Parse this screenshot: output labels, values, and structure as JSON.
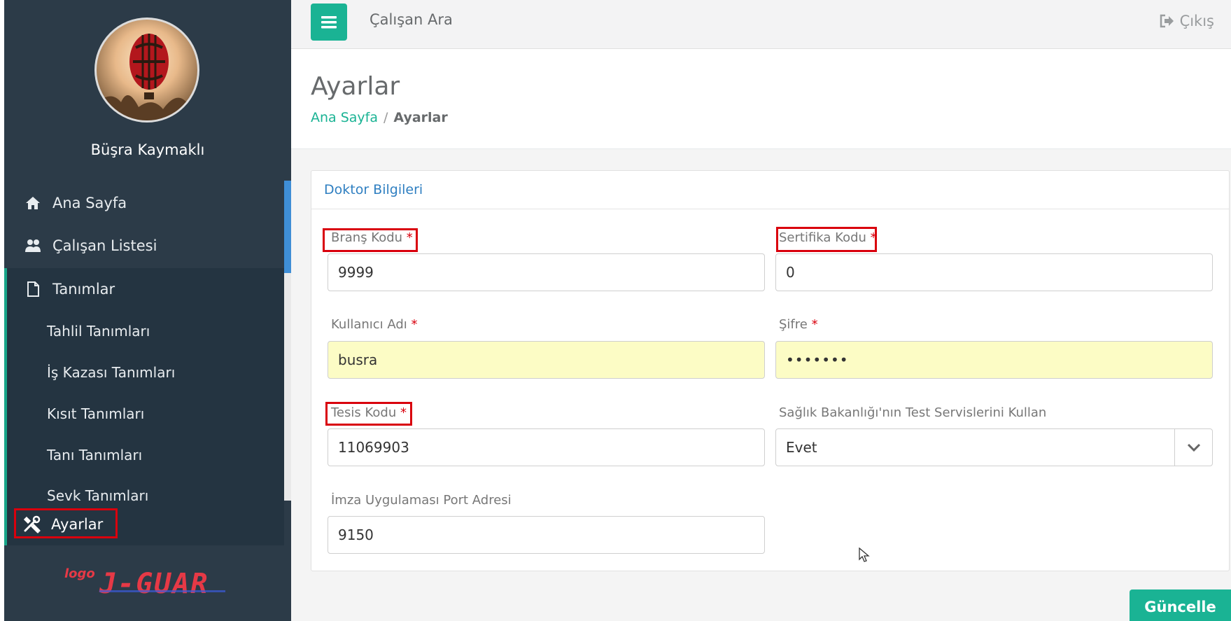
{
  "user": {
    "name": "Büşra Kaymaklı"
  },
  "sidebar": {
    "items": [
      {
        "label": "Ana Sayfa",
        "icon": "home-icon"
      },
      {
        "label": "Çalışan Listesi",
        "icon": "users-icon"
      },
      {
        "label": "Tanımlar",
        "icon": "file-icon"
      }
    ],
    "subitems": [
      {
        "label": "Tahlil Tanımları"
      },
      {
        "label": "İş Kazası Tanımları"
      },
      {
        "label": "Kısıt Tanımları"
      },
      {
        "label": "Tanı Tanımları"
      },
      {
        "label": "Sevk Tanımları"
      }
    ],
    "settings": {
      "label": "Ayarlar",
      "icon": "tools-icon"
    }
  },
  "topbar": {
    "search_label": "Çalışan Ara",
    "logout_label": "Çıkış"
  },
  "heading": {
    "title": "Ayarlar",
    "breadcrumb": {
      "home": "Ana Sayfa",
      "separator": "/",
      "current": "Ayarlar"
    }
  },
  "panel": {
    "title": "Doktor Bilgileri",
    "fields": {
      "brans_kodu": {
        "label": "Branş Kodu",
        "required": "*",
        "value": "9999"
      },
      "sertifika_kodu": {
        "label": "Sertifika Kodu",
        "required": "*",
        "value": "0"
      },
      "kullanici_adi": {
        "label": "Kullanıcı Adı",
        "required": "*",
        "value": "busra"
      },
      "sifre": {
        "label": "Şifre",
        "required": "*",
        "value": "•••••••"
      },
      "tesis_kodu": {
        "label": "Tesis Kodu",
        "required": "*",
        "value": "11069903"
      },
      "test_servisleri": {
        "label": "Sağlık Bakanlığı'nın Test Servislerini Kullan",
        "value": "Evet"
      },
      "imza_port": {
        "label": "İmza Uygulaması Port Adresi",
        "value": "9150"
      }
    }
  },
  "actions": {
    "update_label": "Güncelle"
  },
  "colors": {
    "accent": "#1ab394",
    "sidebar": "#2c3b48",
    "highlight": "#d9000d",
    "link": "#2f7fc1"
  }
}
